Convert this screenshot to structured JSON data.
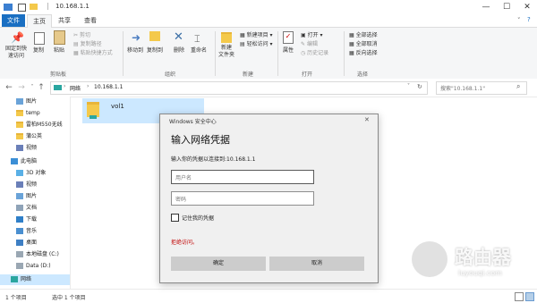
{
  "window": {
    "title": "10.168.1.1",
    "min_label": "—",
    "max_label": "☐",
    "close_label": "✕"
  },
  "ribbon_tabs": [
    "文件",
    "主页",
    "共享",
    "查看"
  ],
  "ribbon": {
    "clipboard": {
      "pin_label": "固定到快\n速访问",
      "copy_label": "复制",
      "paste_label": "粘贴",
      "copy_path_label": "复制路径",
      "paste_shortcut_label": "粘贴快捷方式",
      "cut_label": "剪切",
      "group_label": "剪贴板"
    },
    "organize": {
      "move_to_label": "移动到",
      "copy_to_label": "复制到",
      "delete_label": "删除",
      "rename_label": "重命名",
      "group_label": "组织"
    },
    "new": {
      "new_folder_label": "新建\n文件夹",
      "new_item_label": "新建项目",
      "easy_access_label": "轻松访问",
      "group_label": "新建"
    },
    "open": {
      "properties_label": "属性",
      "open_label": "打开",
      "edit_label": "编辑",
      "history_label": "历史记录",
      "group_label": "打开"
    },
    "select": {
      "select_all_label": "全部选择",
      "select_none_label": "全部取消",
      "invert_label": "反向选择",
      "group_label": "选择"
    }
  },
  "address": {
    "breadcrumb": [
      "网络",
      "10.168.1.1"
    ],
    "search_placeholder": "搜索\"10.168.1.1\""
  },
  "nav_items": [
    {
      "label": "图片",
      "icon": "pictures-icon"
    },
    {
      "label": "temp",
      "icon": "folder-icon"
    },
    {
      "label": "雷柏M550无线",
      "icon": "folder-icon"
    },
    {
      "label": "蒲公英",
      "icon": "folder-icon"
    },
    {
      "label": "视频",
      "icon": "videos-icon"
    },
    {
      "label": "此电脑",
      "icon": "this-pc-icon"
    },
    {
      "label": "3D 对象",
      "icon": "3d-objects-icon"
    },
    {
      "label": "视频",
      "icon": "videos-icon"
    },
    {
      "label": "图片",
      "icon": "pictures-icon"
    },
    {
      "label": "文档",
      "icon": "documents-icon"
    },
    {
      "label": "下载",
      "icon": "downloads-icon"
    },
    {
      "label": "音乐",
      "icon": "music-icon"
    },
    {
      "label": "桌面",
      "icon": "desktop-icon"
    },
    {
      "label": "本地磁盘 (C:)",
      "icon": "drive-icon"
    },
    {
      "label": "Data (D:)",
      "icon": "drive-icon"
    },
    {
      "label": "网络",
      "icon": "network-icon"
    }
  ],
  "content": {
    "items": [
      {
        "label": "vol1"
      }
    ]
  },
  "status": {
    "count": "1 个项目",
    "selected": "选中 1 个项目"
  },
  "dialog": {
    "window_title": "Windows 安全中心",
    "heading": "输入网络凭据",
    "prompt": "输入你的凭据以连接到:10.168.1.1",
    "username_placeholder": "用户名",
    "password_placeholder": "密码",
    "remember_label": "记住我的凭据",
    "error": "拒绝访问。",
    "ok_label": "确定",
    "cancel_label": "取消",
    "close_label": "✕"
  },
  "watermark": {
    "title": "路由器",
    "subtitle": "luyouqi.com"
  },
  "colors": {
    "accent": "#1a6fc2",
    "selection": "#cce8ff",
    "error": "#c00000"
  }
}
